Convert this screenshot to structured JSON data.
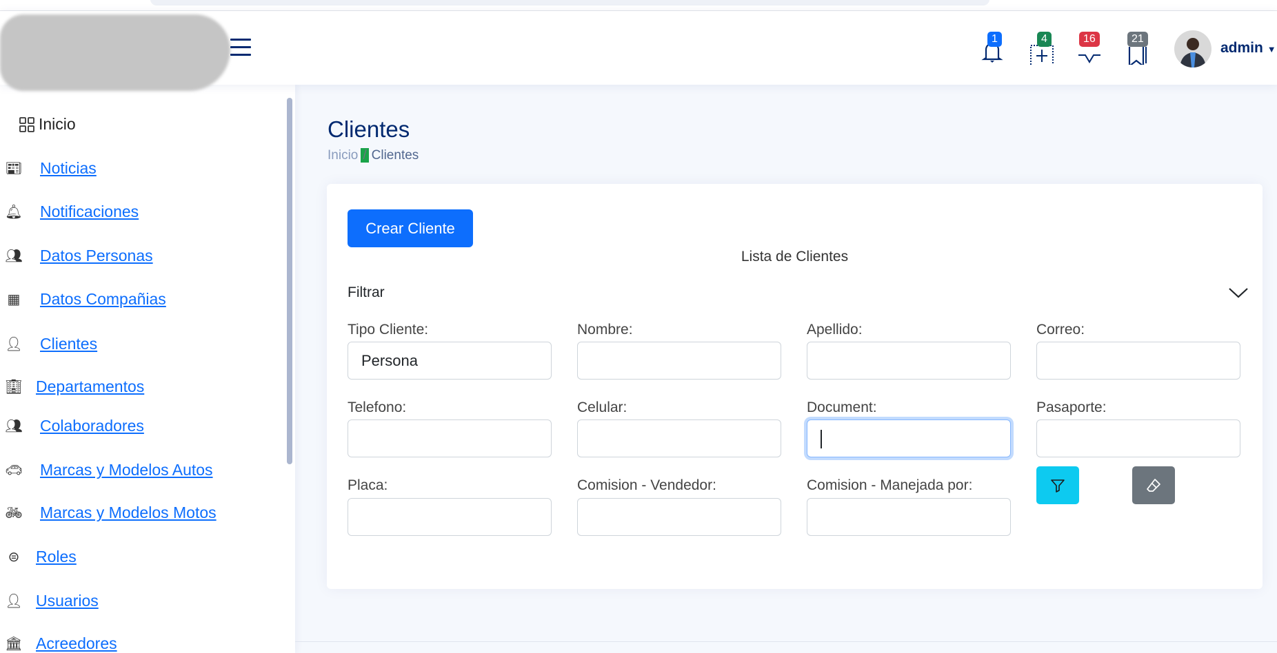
{
  "header": {
    "user": "admin",
    "notifications": [
      {
        "icon": "bell-icon",
        "count": "1",
        "color": "#0d6efd"
      },
      {
        "icon": "plus-square-dotted-icon",
        "count": "4",
        "color": "#198754"
      },
      {
        "icon": "chat-icon",
        "count": "16",
        "color": "#dc3545"
      },
      {
        "icon": "bookmarks-icon",
        "count": "21",
        "color": "#6c757d"
      }
    ]
  },
  "sidebar": {
    "items": [
      {
        "label": "Inicio",
        "icon": "grid-icon"
      },
      {
        "label": "Noticias",
        "icon": "newspaper-icon"
      },
      {
        "label": "Notificaciones",
        "icon": "bell-fill-icon"
      },
      {
        "label": "Datos Personas",
        "icon": "people-icon"
      },
      {
        "label": "Datos Compañias",
        "icon": "building-icon"
      },
      {
        "label": "Clientes",
        "icon": "person-gear-icon"
      },
      {
        "label": "Departamentos",
        "icon": "buildings-icon"
      },
      {
        "label": "Colaboradores",
        "icon": "people-fill-icon"
      },
      {
        "label": "Marcas y Modelos Autos",
        "icon": "car-icon"
      },
      {
        "label": "Marcas y Modelos Motos",
        "icon": "bicycle-icon"
      },
      {
        "label": "Roles",
        "icon": "toggles-icon"
      },
      {
        "label": "Usuarios",
        "icon": "person-gear-icon"
      },
      {
        "label": "Acreedores",
        "icon": "bank-icon"
      }
    ]
  },
  "page": {
    "title": "Clientes",
    "breadcrumb": [
      "Inicio",
      "/",
      "Clientes"
    ],
    "create_button": "Crear Cliente",
    "list_title": "Lista de Clientes",
    "filter_title": "Filtrar",
    "fields": [
      {
        "label": "Tipo Cliente:",
        "value": "Persona"
      },
      {
        "label": "Nombre:",
        "value": ""
      },
      {
        "label": "Apellido:",
        "value": ""
      },
      {
        "label": "Correo:",
        "value": ""
      },
      {
        "label": "Telefono:",
        "value": ""
      },
      {
        "label": "Celular:",
        "value": ""
      },
      {
        "label": "Document:",
        "value": ""
      },
      {
        "label": "Pasaporte:",
        "value": ""
      },
      {
        "label": "Placa:",
        "value": ""
      },
      {
        "label": "Comision - Vendedor:",
        "value": ""
      },
      {
        "label": "Comision - Manejada por:",
        "value": ""
      }
    ],
    "filter_button_color": "#0dcaf0",
    "clear_button_color": "#6c757d"
  }
}
